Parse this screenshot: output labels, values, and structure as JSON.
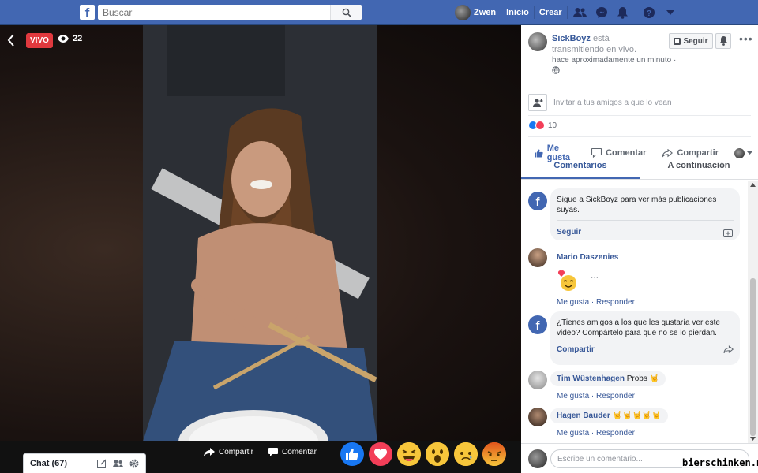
{
  "topbar": {
    "logo": "f",
    "search_placeholder": "Buscar",
    "user_name": "Zwen",
    "nav_home": "Inicio",
    "nav_create": "Crear"
  },
  "video": {
    "live_label": "VIVO",
    "viewer_count": "22",
    "share_label": "Compartir",
    "comment_label": "Comentar",
    "reactions": [
      "like-icon",
      "love-icon",
      "haha-icon",
      "wow-icon",
      "sad-icon",
      "angry-icon"
    ]
  },
  "chat": {
    "label": "Chat (67)"
  },
  "panel": {
    "streamer": "SickBoyz",
    "status_text": " está transmitiendo en vivo.",
    "time_text": "hace aproximadamente un minuto ·",
    "follow_label": "Seguir",
    "invite_text": "Invitar a tus amigos a que lo vean",
    "reaction_count": "10",
    "actions": {
      "like": "Me gusta",
      "comment": "Comentar",
      "share": "Compartir"
    },
    "tabs": [
      "Comentarios",
      "A continuación"
    ]
  },
  "comments": {
    "follow_prompt": {
      "text": "Sigue a SickBoyz para ver más publicaciones suyas.",
      "link": "Seguir"
    },
    "mario": {
      "name": "Mario Daszenies",
      "like": "Me gusta",
      "reply": "Responder"
    },
    "share_prompt": {
      "text": "¿Tienes amigos a los que les gustaría ver este video? Compártelo para que no se lo pierdan.",
      "link": "Compartir"
    },
    "tim": {
      "name": "Tim Wüstenhagen",
      "text": "Probs 🤘",
      "like": "Me gusta",
      "reply": "Responder"
    },
    "hagen": {
      "name": "Hagen Bauder",
      "text": "🤘🤘🤘🤘🤘",
      "like": "Me gusta",
      "reply": "Responder"
    },
    "compose_placeholder": "Escribe un comentario..."
  },
  "watermark": "bierschinken.net",
  "colors": {
    "brand": "#4267b2",
    "live": "#e0393e",
    "link": "#385898"
  }
}
